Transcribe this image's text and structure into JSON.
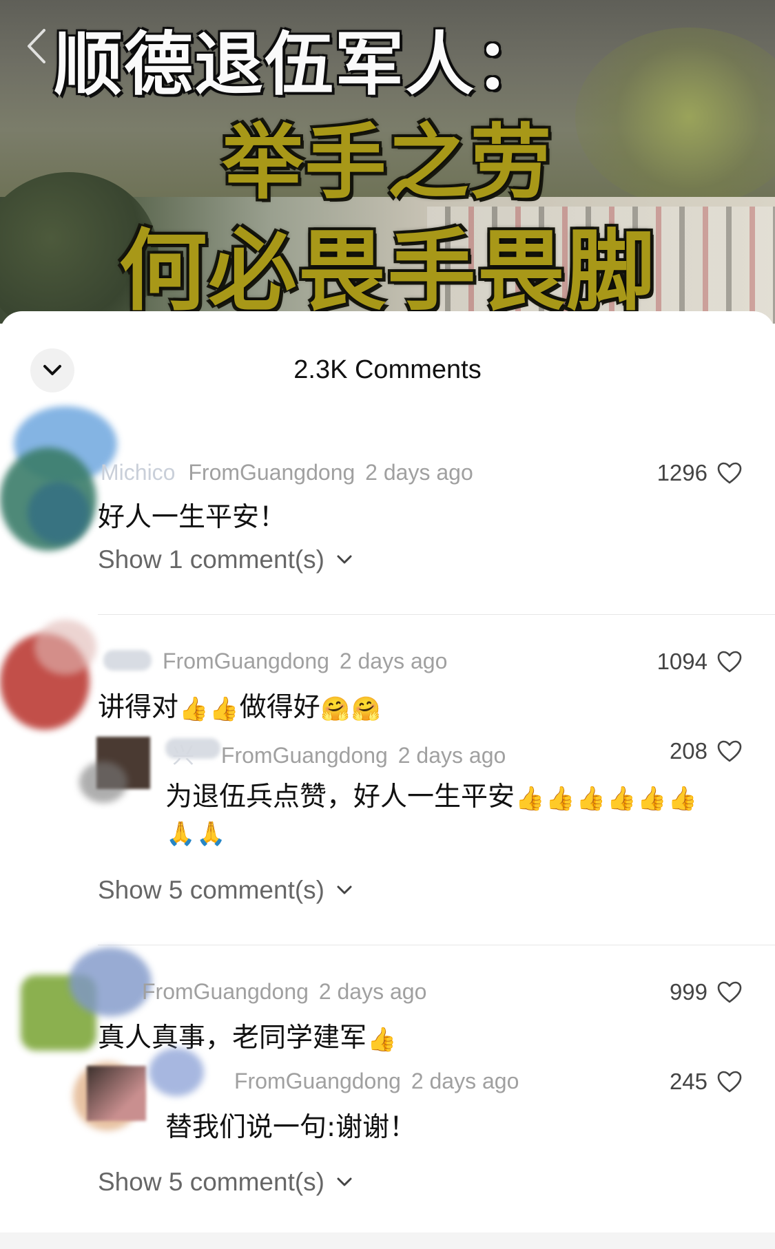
{
  "video": {
    "caption_line1": "顺德退伍军人：",
    "caption_line2": "举手之劳",
    "caption_line3": "何必畏手畏脚",
    "back_icon": "chevron-left-icon"
  },
  "sheet": {
    "title": "2.3K Comments",
    "collapse_icon": "chevron-down-icon"
  },
  "comments": [
    {
      "username": "Michico",
      "location": "FromGuangdong",
      "time": "2 days ago",
      "likes": "1296",
      "text": "好人一生平安！",
      "show_label": "Show 1 comment(s)"
    },
    {
      "location": "FromGuangdong",
      "time": "2 days ago",
      "likes": "1094",
      "text_a": "讲得对",
      "text_b": "做得好",
      "show_label": "Show 5 comment(s)",
      "reply": {
        "username_fragment": "兴",
        "location": "FromGuangdong",
        "time": "2 days ago",
        "likes": "208",
        "text": "为退伍兵点赞，好人一生平安"
      }
    },
    {
      "location": "FromGuangdong",
      "time": "2 days ago",
      "likes": "999",
      "text": "真人真事，老同学建军",
      "show_label": "Show 5 comment(s)",
      "reply": {
        "location": "FromGuangdong",
        "time": "2 days ago",
        "likes": "245",
        "text": "替我们说一句:谢谢！"
      }
    }
  ],
  "icons": {
    "like": "heart-outline-icon",
    "expand": "chevron-down-icon",
    "thumbs_up": "thumbs-up-emoji",
    "hug": "hug-emoji",
    "pray": "pray-emoji"
  },
  "colors": {
    "caption_gold": "#a89818",
    "meta_gray": "#a0a0a0",
    "divider": "#e6e6e6"
  }
}
